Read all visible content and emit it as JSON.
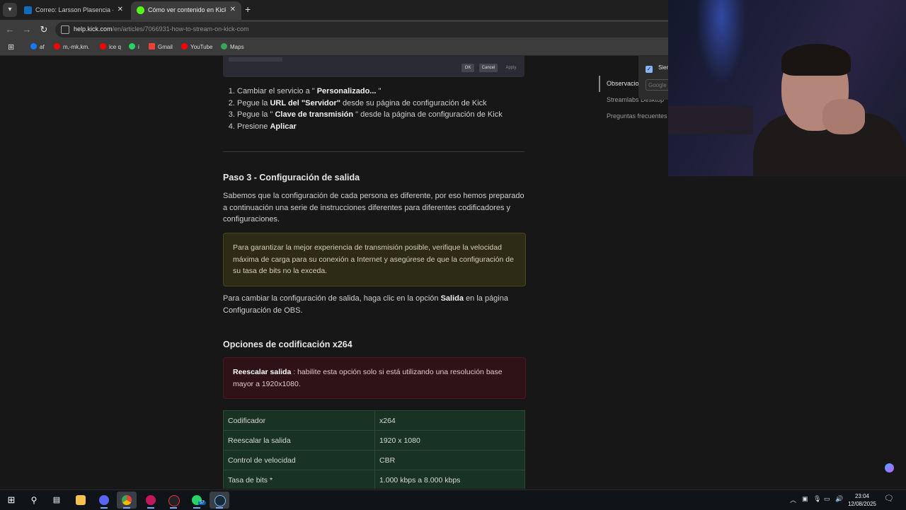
{
  "browser": {
    "tabs": [
      {
        "title": "Correo: Larsson Plasencia - Outlook",
        "active": false,
        "icon_color": "#0f6cbd"
      },
      {
        "title": "Cómo ver contenido en Kick.com",
        "active": true,
        "icon_color": "#53fc18"
      }
    ],
    "tab_close_glyph": "✕",
    "new_tab_glyph": "+",
    "url_host": "help.kick.com",
    "url_path": "/en/articles/7066931-how-to-stream-on-kick-com",
    "bookmarks": [
      {
        "label": "af",
        "icon": "facebook-icon",
        "color": "#1877f2"
      },
      {
        "label": "m,-mk,km.",
        "icon": "youtube-icon",
        "color": "#ff0000"
      },
      {
        "label": "ice q",
        "icon": "youtube-icon",
        "color": "#ff0000"
      },
      {
        "label": "i",
        "icon": "whatsapp-icon",
        "color": "#25d366"
      },
      {
        "label": "Gmail",
        "icon": "gmail-icon",
        "color": "#ea4335"
      },
      {
        "label": "YouTube",
        "icon": "youtube-icon",
        "color": "#ff0000"
      },
      {
        "label": "Maps",
        "icon": "maps-icon",
        "color": "#34a853"
      }
    ]
  },
  "article": {
    "screenshot_buttons": {
      "ok": "OK",
      "cancel": "Cancel",
      "apply": "Apply"
    },
    "steps": [
      {
        "pre": "Cambiar el servicio a \" ",
        "bold": "Personalizado... ",
        "post": "\""
      },
      {
        "pre": "Pegue la ",
        "bold": "URL del \"Servidor\"",
        "post": " desde su página de configuración de Kick"
      },
      {
        "pre": "Pegue la \" ",
        "bold": "Clave de transmisión",
        "post": " \" desde la página de configuración de Kick"
      },
      {
        "pre": "Presione ",
        "bold": "Aplicar",
        "post": ""
      }
    ],
    "step3_heading": "Paso 3 - Configuración de salida",
    "step3_intro": "Sabemos que la configuración de cada persona es diferente, por eso hemos preparado a continuación una serie de instrucciones diferentes para diferentes codificadores y configuraciones.",
    "warning_note": "Para garantizar la mejor experiencia de transmisión posible, verifique la velocidad máxima de carga para su conexión a Internet y asegúrese de que la configuración de su tasa de bits no la exceda.",
    "output_pre": "Para cambiar la configuración de salida, haga clic en la opción ",
    "output_bold": "Salida",
    "output_post": " en la página Configuración de OBS.",
    "x264_heading": "Opciones de codificación x264",
    "rescale_bold": "Reescalar salida",
    "rescale_text": " : habilite esta opción solo si está utilizando una resolución base mayor a 1920x1080.",
    "table": [
      {
        "key": "Codificador",
        "value": "x264"
      },
      {
        "key": "Reescalar la salida",
        "value": "1920 x 1080"
      },
      {
        "key": "Control de velocidad",
        "value": "CBR"
      },
      {
        "key": "Tasa de bits *",
        "value": "1.000 kbps a 8.000 kbps"
      }
    ]
  },
  "toc": {
    "items": [
      {
        "label": "Observaciones",
        "active": true
      },
      {
        "label": "Streamlabs Desktop",
        "active": false
      },
      {
        "label": "Preguntas frecuentes",
        "active": false
      }
    ]
  },
  "popup": {
    "checkbox_label": "Siempre",
    "field_placeholder": "Google"
  },
  "taskbar": {
    "apps": [
      "windows-start-icon",
      "search-icon",
      "task-view-icon",
      "file-explorer-icon",
      "discord-icon",
      "chrome-icon",
      "app-icon",
      "app-icon",
      "whatsapp-icon",
      "steam-icon"
    ],
    "whatsapp_badge": "57",
    "time": "23:04",
    "date": "12/08/2025"
  },
  "colors": {
    "kick_green": "#53fc18",
    "warn_bg": "#2d2a15",
    "danger_bg": "#2e1218",
    "table_bg": "#183323"
  }
}
